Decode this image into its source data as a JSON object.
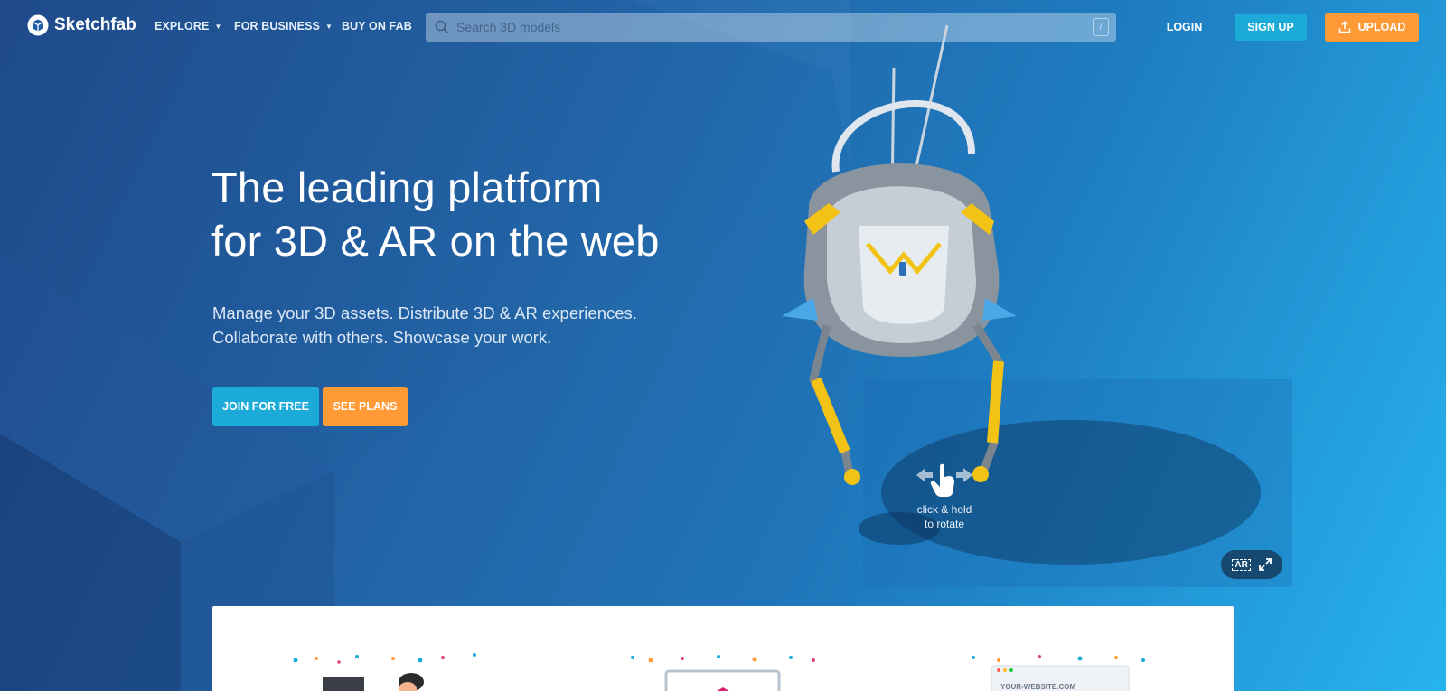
{
  "brand": {
    "name": "Sketchfab"
  },
  "nav": {
    "explore": "EXPLORE",
    "for_business": "FOR BUSINESS",
    "buy_on_fab": "BUY ON FAB"
  },
  "search": {
    "placeholder": "Search 3D models",
    "shortcut": "/"
  },
  "auth": {
    "login": "LOGIN",
    "signup": "SIGN UP",
    "upload": "UPLOAD"
  },
  "hero": {
    "headline_line1": "The leading platform",
    "headline_line2": "for 3D & AR on the web",
    "sub_line1": "Manage your 3D assets. Distribute 3D & AR experiences.",
    "sub_line2": "Collaborate with others. Showcase your work.",
    "join_button": "JOIN FOR FREE",
    "plans_button": "SEE PLANS"
  },
  "viewer": {
    "hint_line1": "click & hold",
    "hint_line2": "to rotate",
    "ar_label": "AR"
  },
  "card": {
    "website_label": "YOUR-WEBSITE.COM"
  },
  "colors": {
    "signup": "#1caad9",
    "upload": "#ff9a36",
    "join": "#1caad9",
    "plans": "#ff9a36"
  }
}
